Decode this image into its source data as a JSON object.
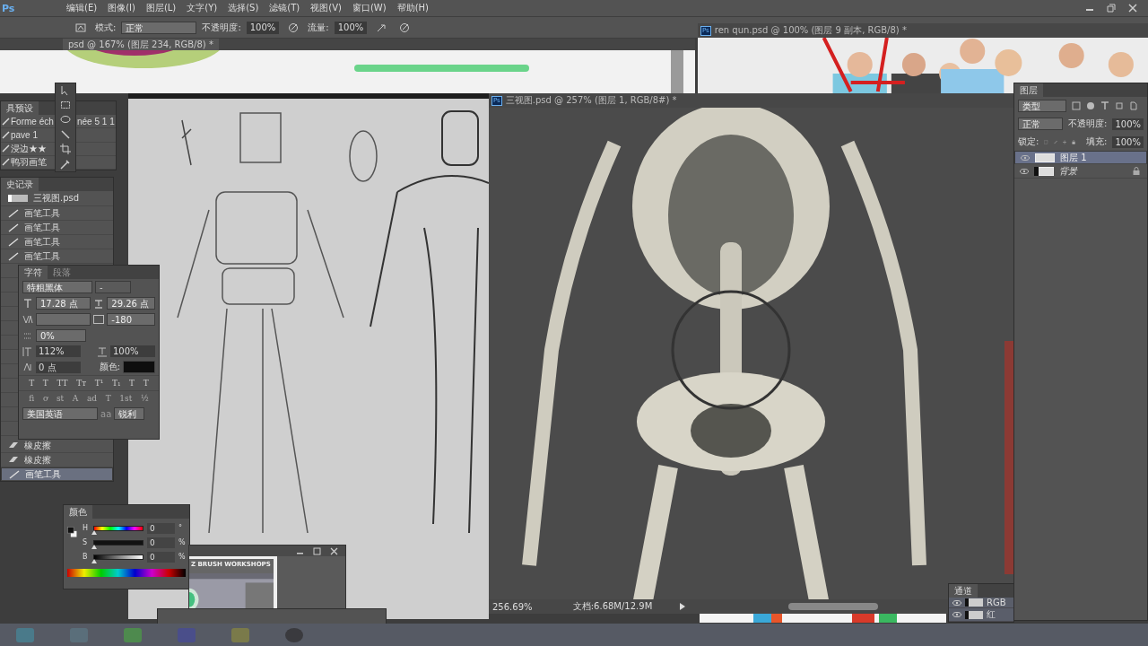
{
  "menu": {
    "logo": "Ps",
    "items": [
      "编辑(E)",
      "图像(I)",
      "图层(L)",
      "文字(Y)",
      "选择(S)",
      "滤镜(T)",
      "视图(V)",
      "窗口(W)",
      "帮助(H)"
    ]
  },
  "options_bar": {
    "mode_label": "模式:",
    "mode": "正常",
    "opacity_label": "不透明度:",
    "opacity": "100%",
    "flow_label": "流量:",
    "flow": "100%"
  },
  "documents": [
    {
      "title": "psd @ 167% (图层 234, RGB/8) *"
    },
    {
      "badge": "Ps",
      "title": "ren qun.psd @ 100% (图层 9 副本, RGB/8) *"
    },
    {
      "badge": "Ps",
      "title": "三视图.psd @ 257% (图层 1, RGB/8#) *",
      "zoom": "256.69%",
      "doc_info": "文档:6.68M/12.9M"
    }
  ],
  "tool_presets": {
    "title": "具预设",
    "items": [
      {
        "label": "Forme éch",
        "label_after": "née 5 1 1"
      },
      {
        "label": "pave 1"
      },
      {
        "label": "浸边★★"
      },
      {
        "label": "鸭羽画笔"
      }
    ]
  },
  "history": {
    "title": "史记录",
    "snapshot": "三视图.psd",
    "items": [
      {
        "kind": "brush",
        "label": "画笔工具",
        "selected": false
      },
      {
        "kind": "brush",
        "label": "画笔工具",
        "selected": false
      },
      {
        "kind": "brush",
        "label": "画笔工具",
        "selected": false
      },
      {
        "kind": "brush",
        "label": "画笔工具",
        "selected": false
      }
    ],
    "bottom_items": [
      {
        "kind": "eraser",
        "label": "橡皮擦",
        "selected": false
      },
      {
        "kind": "eraser",
        "label": "橡皮擦",
        "selected": false
      },
      {
        "kind": "brush",
        "label": "画笔工具",
        "selected": true
      }
    ]
  },
  "character": {
    "tabs": [
      {
        "label": "字符",
        "selected": true
      },
      {
        "label": "段落",
        "selected": false
      }
    ],
    "font": "特粗黑体",
    "font_style": "-",
    "size": "17.28 点",
    "leading": "29.26 点",
    "tracking": "-180",
    "tsume": "0%",
    "vertical_scale": "112%",
    "horizontal_scale": "100%",
    "baseline": "0 点",
    "color_label": "颜色:",
    "styles": [
      "T",
      "T",
      "TT",
      "Tт",
      "T¹",
      "T₁",
      "T",
      "T"
    ],
    "opentype": [
      "fi",
      "ơ",
      "st",
      "A",
      "ad",
      "T",
      "1st",
      "½"
    ],
    "language": "美国英语",
    "aa_label": "aa",
    "antialias": "锐利"
  },
  "color": {
    "title": "颜色",
    "sliders": [
      {
        "label": "H",
        "value": "0",
        "unit": "°",
        "level": 0
      },
      {
        "label": "S",
        "value": "0",
        "unit": "%",
        "level": 0
      },
      {
        "label": "B",
        "value": "0",
        "unit": "%",
        "level": 0
      }
    ]
  },
  "zbrush_window": {
    "banner": "Z BRUSH WORKSHOPS"
  },
  "layers": {
    "title": "图层",
    "filter": "类型",
    "blend": "正常",
    "opacity_label": "不透明度:",
    "opacity": "100%",
    "lock_label": "锁定:",
    "fill_label": "填充:",
    "fill": "100%",
    "items": [
      {
        "name": "图层 1",
        "visible": true,
        "selected": true,
        "locked": false
      },
      {
        "name": "背景",
        "visible": true,
        "selected": false,
        "locked": true
      }
    ]
  },
  "channels": {
    "title": "通道",
    "items": [
      {
        "name": "RGB",
        "visible": true
      },
      {
        "name": "红",
        "visible": true
      }
    ]
  }
}
